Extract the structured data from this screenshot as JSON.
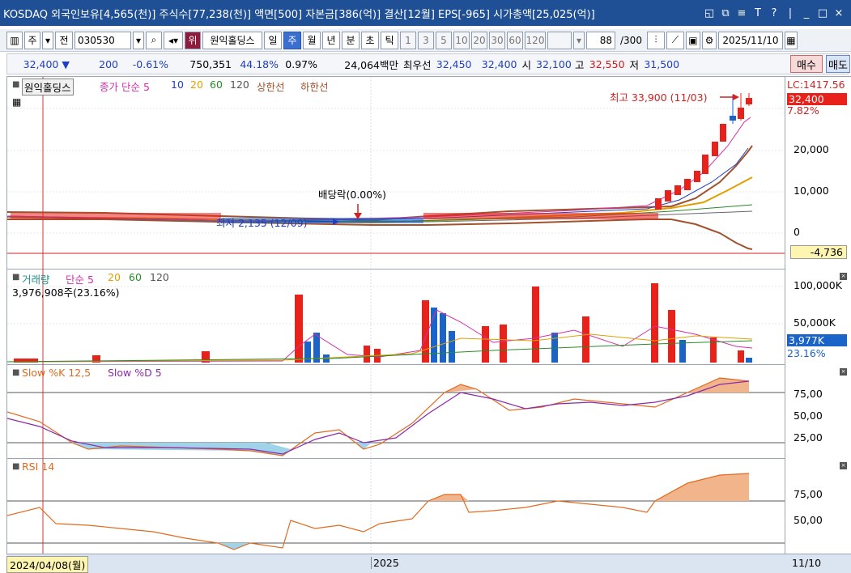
{
  "titlebar": {
    "text": "KOSDAQ 외국인보유[4,565(천)] 주식수[77,238(천)] 액면[500] 자본금[386(억)] 결산[12월] EPS[-965] 시가총액[25,025(억)]",
    "controls": [
      "◱",
      "⧉",
      "≡",
      "T",
      "?",
      "|",
      "_",
      "□",
      "×"
    ]
  },
  "toolbar": {
    "period_select": "주",
    "jeon_label": "전",
    "code": "030530",
    "wi_label": "위",
    "stock_name": "원익홀딩스",
    "period_tabs": [
      "일",
      "주",
      "월",
      "년"
    ],
    "active_period": "주",
    "minute_tabs": [
      "분",
      "초",
      "틱"
    ],
    "minute_values": [
      "1",
      "3",
      "5",
      "10",
      "20",
      "30",
      "60",
      "120"
    ],
    "count": "88",
    "count_total": "/300",
    "date": "2025/11/10"
  },
  "infobar": {
    "price": "32,400",
    "change_arrow": "▼",
    "change": "200",
    "change_pct": "-0.61%",
    "volume": "750,351",
    "vol_ratio": "44.18%",
    "turnover": "0.97%",
    "amount": "24,064백만",
    "best_ask_label": "최우선",
    "best_ask": "32,450",
    "best_bid": "32,400",
    "open_label": "시",
    "open": "32,100",
    "high_label": "고",
    "high": "32,550",
    "low_label": "저",
    "low": "31,500",
    "buy_label": "매수",
    "sell_label": "매도"
  },
  "price_pane": {
    "legend_name": "원익홀딩스",
    "legend_items": [
      {
        "text": "종가 단순 5",
        "color": "#d42fa8"
      },
      {
        "text": "10",
        "color": "#1f3fc4"
      },
      {
        "text": "20",
        "color": "#e0a000"
      },
      {
        "text": "60",
        "color": "#2a8a2a"
      },
      {
        "text": "120",
        "color": "#555555"
      },
      {
        "text": "상한선",
        "color": "#a0522d"
      },
      {
        "text": "하한선",
        "color": "#a0522d"
      }
    ],
    "high_note": "최고 33,900 (11/03)",
    "low_note": "최저 2,135 (12/09)",
    "dividend_note": "배당락(0.00%)",
    "lc_label": "LC:1417.56",
    "price_tag": "32,400",
    "pct_tag": "7.82%",
    "neg_tag": "-4,736",
    "yticks": [
      "20,000",
      "10,000",
      "0"
    ]
  },
  "volume_pane": {
    "legend": [
      {
        "text": "거래량",
        "color": "#1f8f8f"
      },
      {
        "text": "단순 5",
        "color": "#d42fa8"
      },
      {
        "text": "20",
        "color": "#e0a000"
      },
      {
        "text": "60",
        "color": "#2a8a2a"
      },
      {
        "text": "120",
        "color": "#555555"
      }
    ],
    "current": "3,976,908주(23.16%)",
    "tag": "3,977K",
    "tag_pct": "23.16%",
    "yticks": [
      "100,000K",
      "50,000K"
    ]
  },
  "stoch_pane": {
    "legend": [
      {
        "text": "Slow %K 12,5",
        "color": "#e06a1f"
      },
      {
        "text": "Slow %D 5",
        "color": "#8a2aa8"
      }
    ],
    "yticks": [
      "75,00",
      "50,00",
      "25,00"
    ]
  },
  "rsi_pane": {
    "legend": [
      {
        "text": "RSI 14",
        "color": "#e06a1f"
      }
    ],
    "yticks": [
      "75,00",
      "50,00"
    ]
  },
  "bottom": {
    "cursor_date": "2024/04/08(월)",
    "year_label": "2025",
    "last_label": "11/10"
  },
  "colors": {
    "up": "#e8221b",
    "down": "#1a63c9",
    "title_bg": "#1f4f94"
  }
}
